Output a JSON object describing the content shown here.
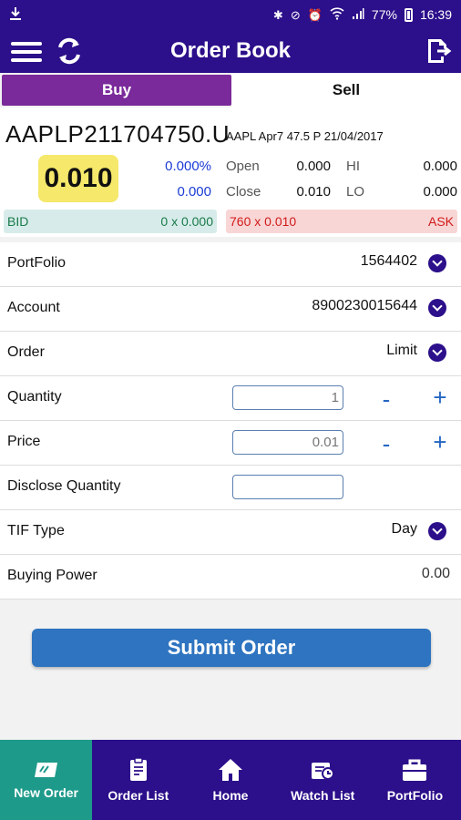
{
  "status_bar": {
    "battery": "77%",
    "time": "16:39"
  },
  "appbar": {
    "title": "Order Book"
  },
  "tabs": {
    "buy": "Buy",
    "sell": "Sell"
  },
  "quote": {
    "symbol": "AAPLP211704750.U",
    "description": "AAPL Apr7 47.5 P 21/04/2017",
    "last_price": "0.010",
    "change_pct": "0.000%",
    "change": "0.000",
    "open_label": "Open",
    "open": "0.000",
    "close_label": "Close",
    "close": "0.010",
    "hi_label": "HI",
    "hi": "0.000",
    "lo_label": "LO",
    "lo": "0.000",
    "bid_label": "BID",
    "bid_value": "0 x 0.000",
    "ask_label": "ASK",
    "ask_value": "760 x 0.010"
  },
  "form": {
    "portfolio_label": "PortFolio",
    "portfolio_value": "1564402",
    "account_label": "Account",
    "account_value": "8900230015644",
    "order_label": "Order",
    "order_value": "Limit",
    "quantity_label": "Quantity",
    "quantity_value": "1",
    "price_label": "Price",
    "price_value": "0.01",
    "disclose_label": "Disclose Quantity",
    "disclose_value": "",
    "tif_label": "TIF Type",
    "tif_value": "Day",
    "buying_power_label": "Buying Power",
    "buying_power_value": "0.00",
    "minus": "-",
    "plus": "+"
  },
  "submit_label": "Submit Order",
  "bottom_nav": [
    {
      "label": "New Order",
      "icon": "new-order-icon",
      "active": true
    },
    {
      "label": "Order List",
      "icon": "order-list-icon",
      "active": false
    },
    {
      "label": "Home",
      "icon": "home-icon",
      "active": false
    },
    {
      "label": "Watch List",
      "icon": "watch-list-icon",
      "active": false
    },
    {
      "label": "PortFolio",
      "icon": "portfolio-icon",
      "active": false
    }
  ],
  "colors": {
    "primary": "#2c0f8a",
    "buy_tab": "#7a2a9a",
    "active_nav": "#1d9a8a",
    "submit": "#2e74c0"
  }
}
